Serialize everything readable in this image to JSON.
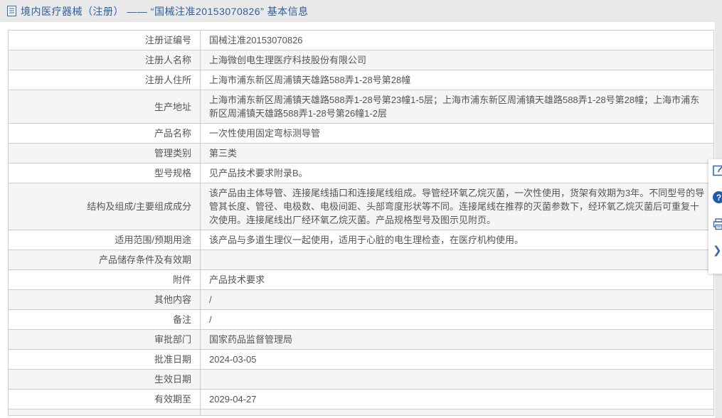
{
  "page": {
    "title": "境内医疗器械（注册） —— “国械注准20153070826” 基本信息",
    "colors": {
      "title_blue": "#2e5f9e",
      "icon_blue": "#3a6ba5",
      "help_circle_blue": "#1d5cad",
      "page_bg": "#e9e9e9",
      "panel_bg": "#ffffff",
      "stripe_bg": "#f5f5f5",
      "border": "#cccccc",
      "text": "#555555"
    }
  },
  "table": {
    "rows": [
      {
        "label": "注册证编号",
        "value": "国械注准20153070826"
      },
      {
        "label": "注册人名称",
        "value": "上海微创电生理医疗科技股份有限公司"
      },
      {
        "label": "注册人住所",
        "value": "上海市浦东新区周浦镇天雄路588弄1-28号第28幢"
      },
      {
        "label": "生产地址",
        "value": "上海市浦东新区周浦镇天雄路588弄1-28号第23幢1-5层；上海市浦东新区周浦镇天雄路588弄1-28号第28幢；上海市浦东新区周浦镇天雄路588弄1-28号第26幢1-2层"
      },
      {
        "label": "产品名称",
        "value": "一次性使用固定弯标测导管"
      },
      {
        "label": "管理类别",
        "value": "第三类"
      },
      {
        "label": "型号规格",
        "value": "见产品技术要求附录B。"
      },
      {
        "label": "结构及组成/主要组成成分",
        "value": "该产品由主体导管、连接尾线插口和连接尾线组成。导管经环氧乙烷灭菌，一次性使用，货架有效期为3年。不同型号的导管其长度、管径、电极数、电极间距、头部弯度形状等不同。连接尾线在推荐的灭菌参数下，经环氧乙烷灭菌后可重复十次使用。连接尾线出厂经环氧乙烷灭菌。产品规格型号及图示见附页。"
      },
      {
        "label": "适用范围/预期用途",
        "value": "该产品与多道生理仪一起使用，适用于心脏的电生理检查，在医疗机构使用。"
      },
      {
        "label": "产品储存条件及有效期",
        "value": ""
      },
      {
        "label": "附件",
        "value": "产品技术要求"
      },
      {
        "label": "其他内容",
        "value": "/"
      },
      {
        "label": "备注",
        "value": "/"
      },
      {
        "label": "审批部门",
        "value": "国家药品监督管理局"
      },
      {
        "label": "批准日期",
        "value": "2024-03-05"
      },
      {
        "label": "生效日期",
        "value": ""
      },
      {
        "label": "有效期至",
        "value": "2029-04-27"
      },
      {
        "label": "",
        "value": ""
      }
    ]
  },
  "side_toolbar": {
    "icons": [
      {
        "name": "correction-icon"
      },
      {
        "name": "help-icon",
        "glyph": "?"
      },
      {
        "name": "print-icon"
      },
      {
        "name": "collapse-icon",
        "glyph": "❯"
      }
    ]
  }
}
